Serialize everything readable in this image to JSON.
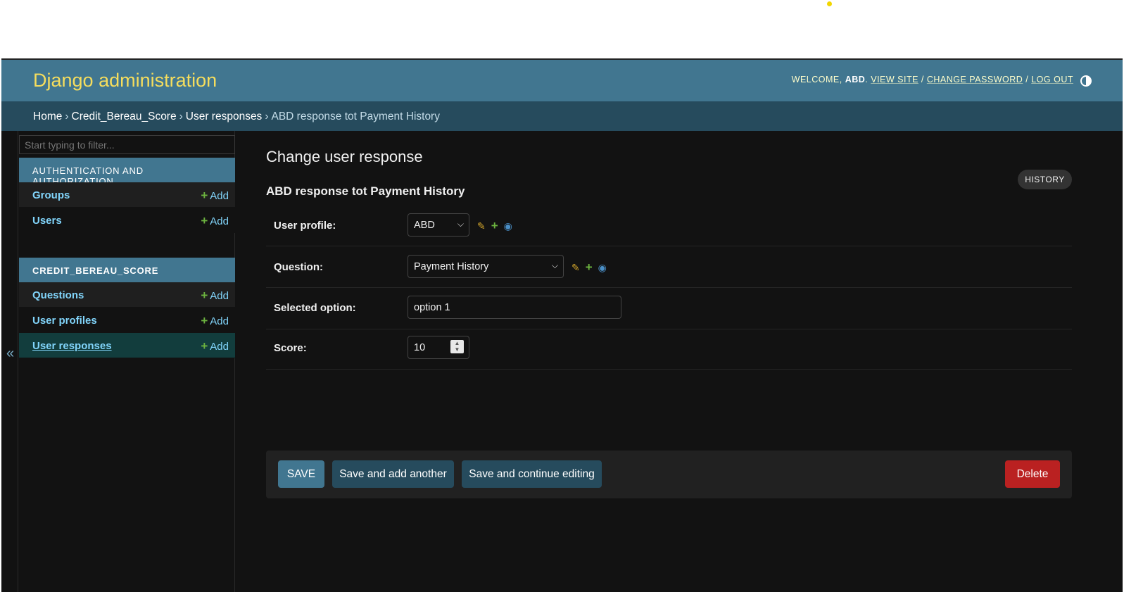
{
  "header": {
    "brand": "Django administration",
    "welcome": "WELCOME,",
    "username": "ABD",
    "view_site": "VIEW SITE",
    "change_password": "CHANGE PASSWORD",
    "log_out": "LOG OUT"
  },
  "breadcrumbs": [
    "Home",
    "Credit_Bereau_Score",
    "User responses",
    "ABD response tot Payment History"
  ],
  "sidebar": {
    "filter_placeholder": "Start typing to filter...",
    "toggle_icon": "«",
    "modules": [
      {
        "caption": "AUTHENTICATION AND AUTHORIZATION",
        "models": [
          {
            "name": "Groups",
            "add": "Add"
          },
          {
            "name": "Users",
            "add": "Add"
          }
        ]
      },
      {
        "caption": "CREDIT_BEREAU_SCORE",
        "models": [
          {
            "name": "Questions",
            "add": "Add"
          },
          {
            "name": "User profiles",
            "add": "Add"
          },
          {
            "name": "User responses",
            "add": "Add"
          }
        ]
      }
    ]
  },
  "main": {
    "page_title": "Change user response",
    "object_title": "ABD response tot Payment History",
    "history_label": "HISTORY",
    "fields": {
      "user_profile": {
        "label": "User profile:",
        "value": "ABD"
      },
      "question": {
        "label": "Question:",
        "value": "Payment History"
      },
      "selected_option": {
        "label": "Selected option:",
        "value": "option 1"
      },
      "score": {
        "label": "Score:",
        "value": "10"
      }
    },
    "buttons": {
      "save": "SAVE",
      "save_add_another": "Save and add another",
      "save_continue": "Save and continue editing",
      "delete": "Delete"
    }
  },
  "colors": {
    "header_bg": "#417690",
    "brand": "#f5dd5d",
    "breadcrumb_bg": "#264b5d",
    "link": "#81d4fa",
    "delete": "#ba2121",
    "add": "#6cb33f"
  }
}
